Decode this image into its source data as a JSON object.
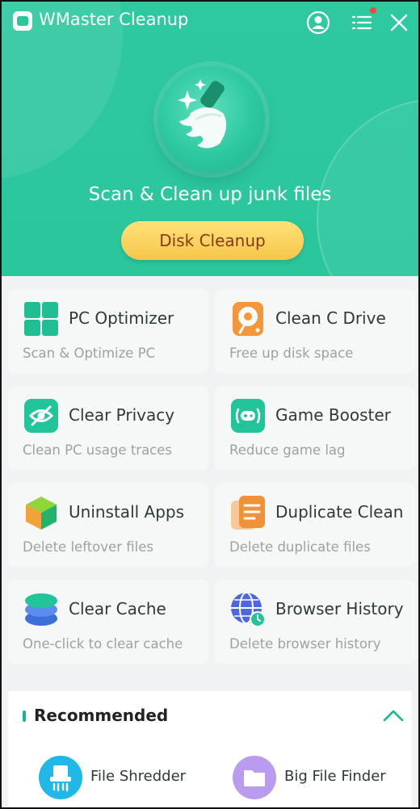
{
  "window": {
    "title": "WMaster Cleanup"
  },
  "header": {
    "heading": "Scan & Clean up junk files",
    "cta_label": "Disk Cleanup",
    "icons": [
      "user-icon",
      "menu-icon",
      "close-icon",
      "broom-icon"
    ]
  },
  "features": [
    {
      "title": "PC Optimizer",
      "subtitle": "Scan & Optimize PC",
      "icon": "windows-grid-icon"
    },
    {
      "title": "Clean C Drive",
      "subtitle": "Free up disk space",
      "icon": "disk-icon"
    },
    {
      "title": "Clear Privacy",
      "subtitle": "Clean PC usage traces",
      "icon": "eye-off-icon"
    },
    {
      "title": "Game Booster",
      "subtitle": "Reduce game lag",
      "icon": "gamepad-icon"
    },
    {
      "title": "Uninstall Apps",
      "subtitle": "Delete leftover files",
      "icon": "cube-icon"
    },
    {
      "title": "Duplicate Clean",
      "subtitle": "Delete duplicate files",
      "icon": "duplicate-doc-icon"
    },
    {
      "title": "Clear Cache",
      "subtitle": "One-click to clear cache",
      "icon": "database-icon"
    },
    {
      "title": "Browser History",
      "subtitle": "Delete browser history",
      "icon": "globe-clock-icon"
    }
  ],
  "recommended": {
    "title": "Recommended",
    "items": [
      {
        "label": "File Shredder",
        "icon": "shredder-icon"
      },
      {
        "label": "Big File Finder",
        "icon": "folder-icon"
      }
    ]
  },
  "colors": {
    "accent": "#2bc69c",
    "cta": "#f6c64a",
    "cta_text": "#8a3a10"
  }
}
